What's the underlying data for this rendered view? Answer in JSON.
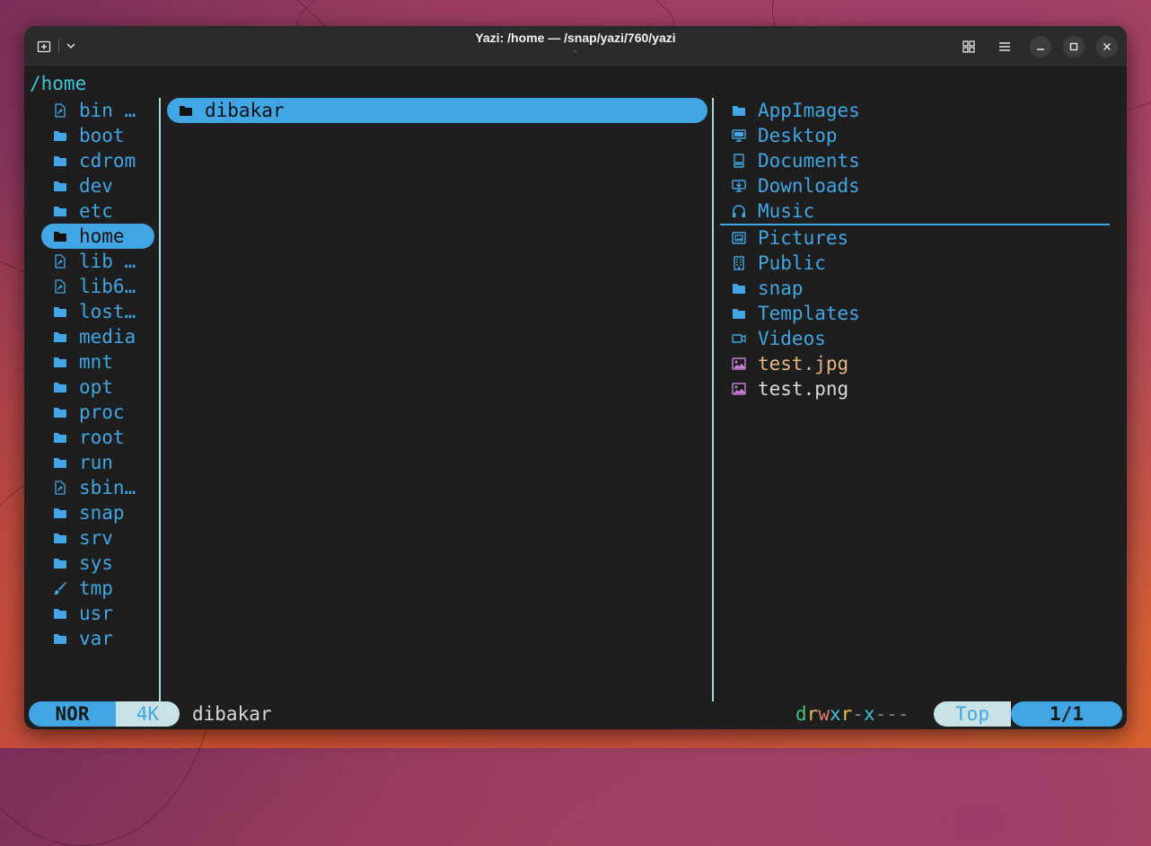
{
  "window": {
    "title": "Yazi: /home — /snap/yazi/760/yazi",
    "subtitle": "~"
  },
  "cwd": "/home",
  "parent_pane": {
    "items": [
      {
        "name": "bin …",
        "icon": "symlink-icon"
      },
      {
        "name": "boot",
        "icon": "folder-icon"
      },
      {
        "name": "cdrom",
        "icon": "folder-icon"
      },
      {
        "name": "dev",
        "icon": "folder-icon"
      },
      {
        "name": "etc",
        "icon": "folder-icon"
      },
      {
        "name": "home",
        "icon": "folder-icon",
        "selected": true
      },
      {
        "name": "lib …",
        "icon": "symlink-icon"
      },
      {
        "name": "lib6…",
        "icon": "symlink-icon"
      },
      {
        "name": "lost…",
        "icon": "folder-icon"
      },
      {
        "name": "media",
        "icon": "folder-icon"
      },
      {
        "name": "mnt",
        "icon": "folder-icon"
      },
      {
        "name": "opt",
        "icon": "folder-icon"
      },
      {
        "name": "proc",
        "icon": "folder-icon"
      },
      {
        "name": "root",
        "icon": "folder-icon"
      },
      {
        "name": "run",
        "icon": "folder-icon"
      },
      {
        "name": "sbin…",
        "icon": "symlink-icon"
      },
      {
        "name": "snap",
        "icon": "folder-icon"
      },
      {
        "name": "srv",
        "icon": "folder-icon"
      },
      {
        "name": "sys",
        "icon": "folder-icon"
      },
      {
        "name": "tmp",
        "icon": "brush-icon"
      },
      {
        "name": "usr",
        "icon": "folder-icon"
      },
      {
        "name": "var",
        "icon": "folder-icon"
      }
    ]
  },
  "current_pane": {
    "items": [
      {
        "name": "dibakar",
        "icon": "folder-icon",
        "selected": true
      }
    ]
  },
  "preview_pane": {
    "items": [
      {
        "name": "AppImages",
        "icon": "folder-icon"
      },
      {
        "name": "Desktop",
        "icon": "desktop-icon"
      },
      {
        "name": "Documents",
        "icon": "document-icon"
      },
      {
        "name": "Downloads",
        "icon": "download-icon"
      },
      {
        "name": "Music",
        "icon": "headphones-icon"
      },
      {
        "name": "Pictures",
        "icon": "picture-icon"
      },
      {
        "name": "Public",
        "icon": "building-icon"
      },
      {
        "name": "snap",
        "icon": "folder-icon"
      },
      {
        "name": "Templates",
        "icon": "folder-icon"
      },
      {
        "name": "Videos",
        "icon": "video-icon"
      },
      {
        "name": "test.jpg",
        "icon": "image-file-icon"
      },
      {
        "name": "test.png",
        "icon": "image-file-icon"
      }
    ]
  },
  "status": {
    "mode": "NOR",
    "size": "4K",
    "hovered": "dibakar",
    "permissions": [
      "d",
      "r",
      "w",
      "x",
      "r",
      "-",
      "x",
      "-",
      "-",
      "-"
    ],
    "position": "Top",
    "count": "1/1"
  },
  "colors": {
    "accent": "#41a6e3",
    "cwd": "#3ec4d6",
    "background": "#1e1e1e",
    "jpg": "#e6b684",
    "image_icon": "#c77fd6"
  }
}
